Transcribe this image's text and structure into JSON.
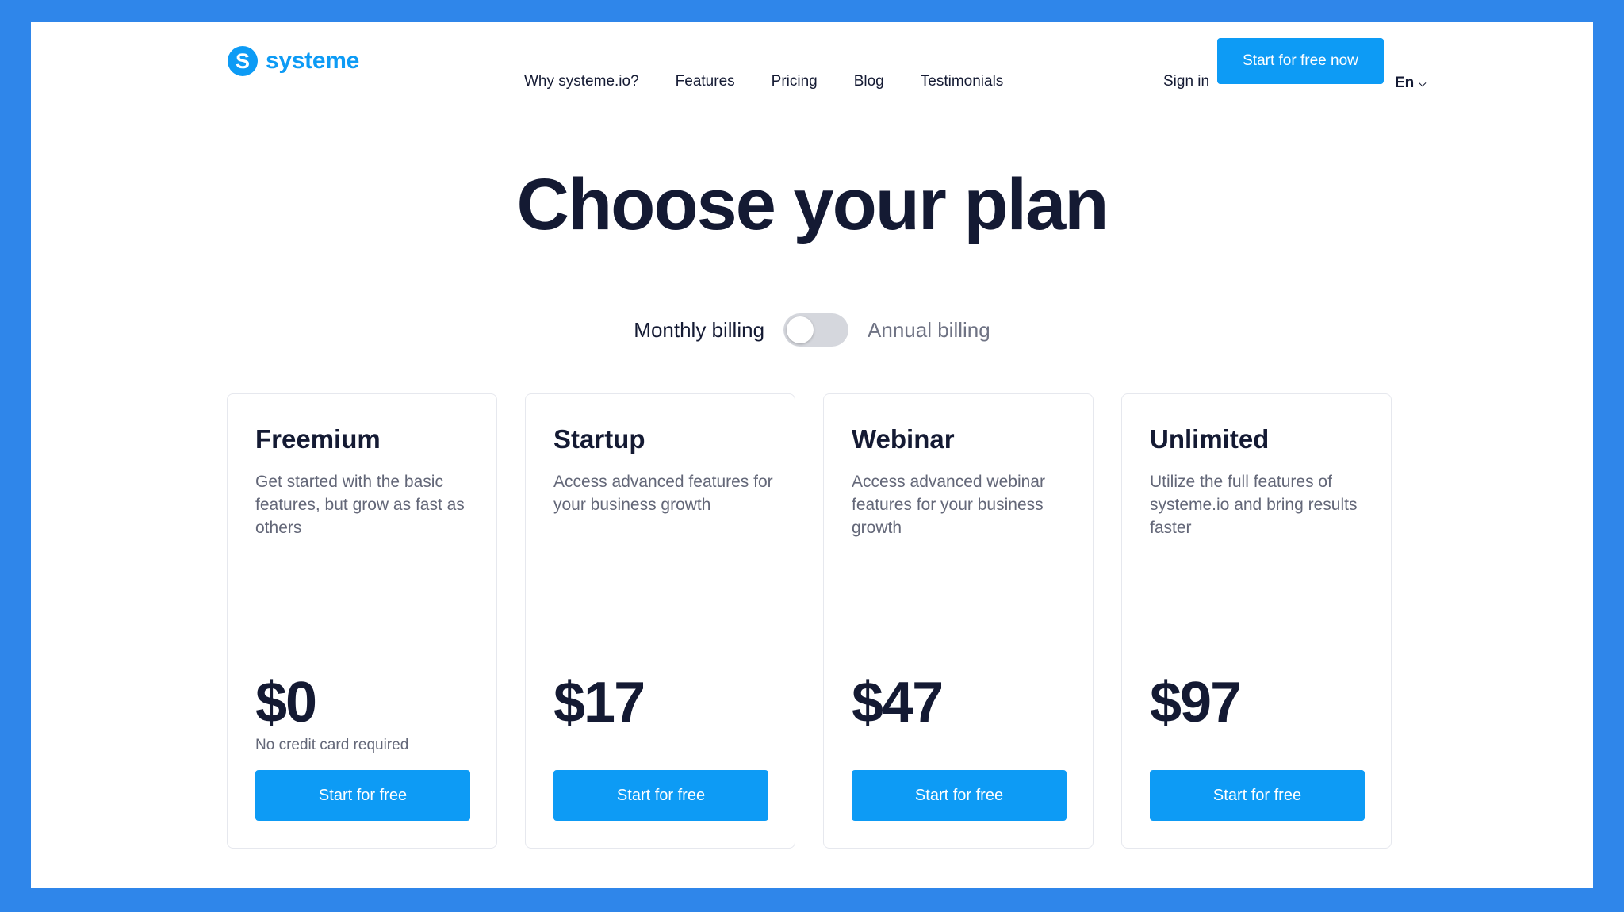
{
  "header": {
    "logo_letter": "S",
    "logo_text": "systeme",
    "nav": [
      "Why systeme.io?",
      "Features",
      "Pricing",
      "Blog",
      "Testimonials"
    ],
    "sign_in": "Sign in",
    "cta": "Start for free now",
    "language": "En"
  },
  "main": {
    "title": "Choose your plan",
    "billing": {
      "monthly_label": "Monthly billing",
      "annual_label": "Annual billing",
      "annual_selected": false
    },
    "plans": [
      {
        "name": "Freemium",
        "description": "Get started with the basic features, but grow as fast as others",
        "price": "$0",
        "note": "No credit card required",
        "button": "Start for free"
      },
      {
        "name": "Startup",
        "description": "Access advanced features for your business growth",
        "price": "$17",
        "note": "",
        "button": "Start for free"
      },
      {
        "name": "Webinar",
        "description": "Access advanced webinar features for your business growth",
        "price": "$47",
        "note": "",
        "button": "Start for free"
      },
      {
        "name": "Unlimited",
        "description": "Utilize the full features of systeme.io and bring results faster",
        "price": "$97",
        "note": "",
        "button": "Start for free"
      }
    ]
  },
  "colors": {
    "accent": "#0d9bf5",
    "frame": "#2f86ea",
    "heading": "#141a33",
    "muted_text": "#636778"
  },
  "icons": {
    "logo": "systeme-logo-icon",
    "language_dropdown": "chevron-down-icon"
  }
}
